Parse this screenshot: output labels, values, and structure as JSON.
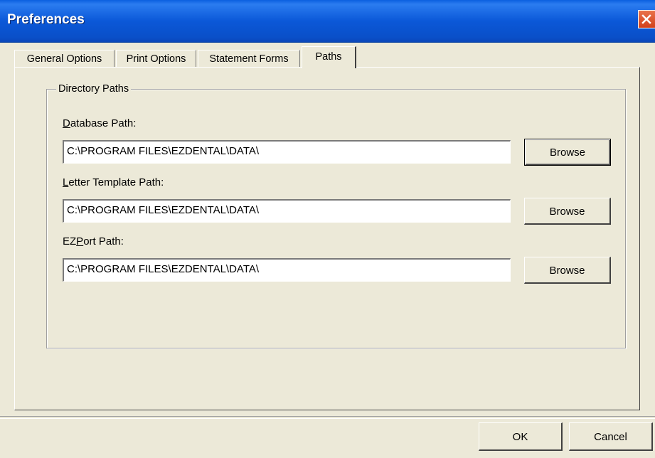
{
  "window": {
    "title": "Preferences",
    "close_icon": "close-icon"
  },
  "tabs": [
    {
      "label": "General Options",
      "active": false
    },
    {
      "label": "Print Options",
      "active": false
    },
    {
      "label": "Statement Forms",
      "active": false
    },
    {
      "label": "Paths",
      "active": true
    }
  ],
  "group": {
    "legend": "Directory Paths",
    "fields": [
      {
        "label_mnemonic": "D",
        "label_rest": "atabase Path:",
        "value": "C:\\PROGRAM FILES\\EZDENTAL\\DATA\\",
        "button": "Browse"
      },
      {
        "label_mnemonic": "L",
        "label_rest": "etter Template Path:",
        "value": "C:\\PROGRAM FILES\\EZDENTAL\\DATA\\",
        "button": "Browse"
      },
      {
        "label_prefix": "EZ",
        "label_mnemonic": "P",
        "label_rest": "ort Path:",
        "value": "C:\\PROGRAM FILES\\EZDENTAL\\DATA\\",
        "button": "Browse"
      }
    ]
  },
  "footer": {
    "ok_label": "OK",
    "cancel_label": "Cancel"
  }
}
